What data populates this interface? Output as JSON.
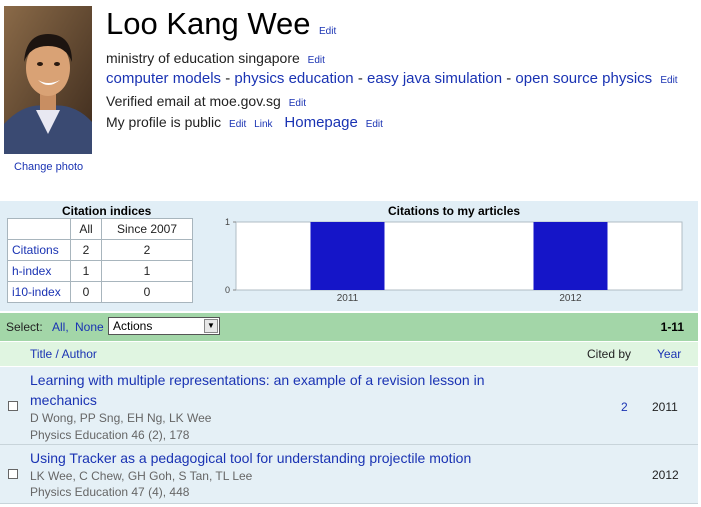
{
  "profile": {
    "name": "Loo Kang Wee",
    "edit_label": "Edit",
    "affiliation": "ministry of education singapore",
    "interests": [
      "computer models",
      "physics education",
      "easy java simulation",
      "open source physics"
    ],
    "interest_separator": " - ",
    "email": "Verified email at moe.gov.sg",
    "public_status": "My profile is public",
    "link_label": "Link",
    "homepage_label": "Homepage",
    "change_photo": "Change photo"
  },
  "citation_indices": {
    "title": "Citation indices",
    "columns": [
      "All",
      "Since 2007"
    ],
    "rows": [
      {
        "label": "Citations",
        "all": "2",
        "since": "2"
      },
      {
        "label": "h-index",
        "all": "1",
        "since": "1"
      },
      {
        "label": "i10-index",
        "all": "0",
        "since": "0"
      }
    ]
  },
  "chart_data": {
    "type": "bar",
    "title": "Citations to my articles",
    "categories": [
      "2011",
      "2012"
    ],
    "values": [
      1,
      1
    ],
    "yticks": [
      "0",
      "1"
    ],
    "ylim": [
      0,
      1
    ],
    "bar_color": "#1515c8"
  },
  "actions_bar": {
    "select_label": "Select:",
    "all_label": "All,",
    "none_label": "None",
    "actions_value": "Actions",
    "range": "1-11"
  },
  "articles_header": {
    "title_author": "Title / Author",
    "cited_by": "Cited by",
    "year": "Year"
  },
  "articles": [
    {
      "title": "Learning with multiple representations: an example of a revision lesson in mechanics",
      "authors": "D Wong, PP Sng, EH Ng, LK Wee",
      "publication": "Physics Education 46 (2), 178",
      "cited_by": "2",
      "year": "2011"
    },
    {
      "title": "Using Tracker as a pedagogical tool for understanding projectile motion",
      "authors": "LK Wee, C Chew, GH Goh, S Tan, TL Lee",
      "publication": "Physics Education 47 (4), 448",
      "cited_by": "",
      "year": "2012"
    }
  ],
  "colors": {
    "link": "#1a33b3",
    "stats_bg": "#e1eef6",
    "action_bar_bg": "#a3d6a8",
    "header_bg": "#e0f5e1"
  }
}
